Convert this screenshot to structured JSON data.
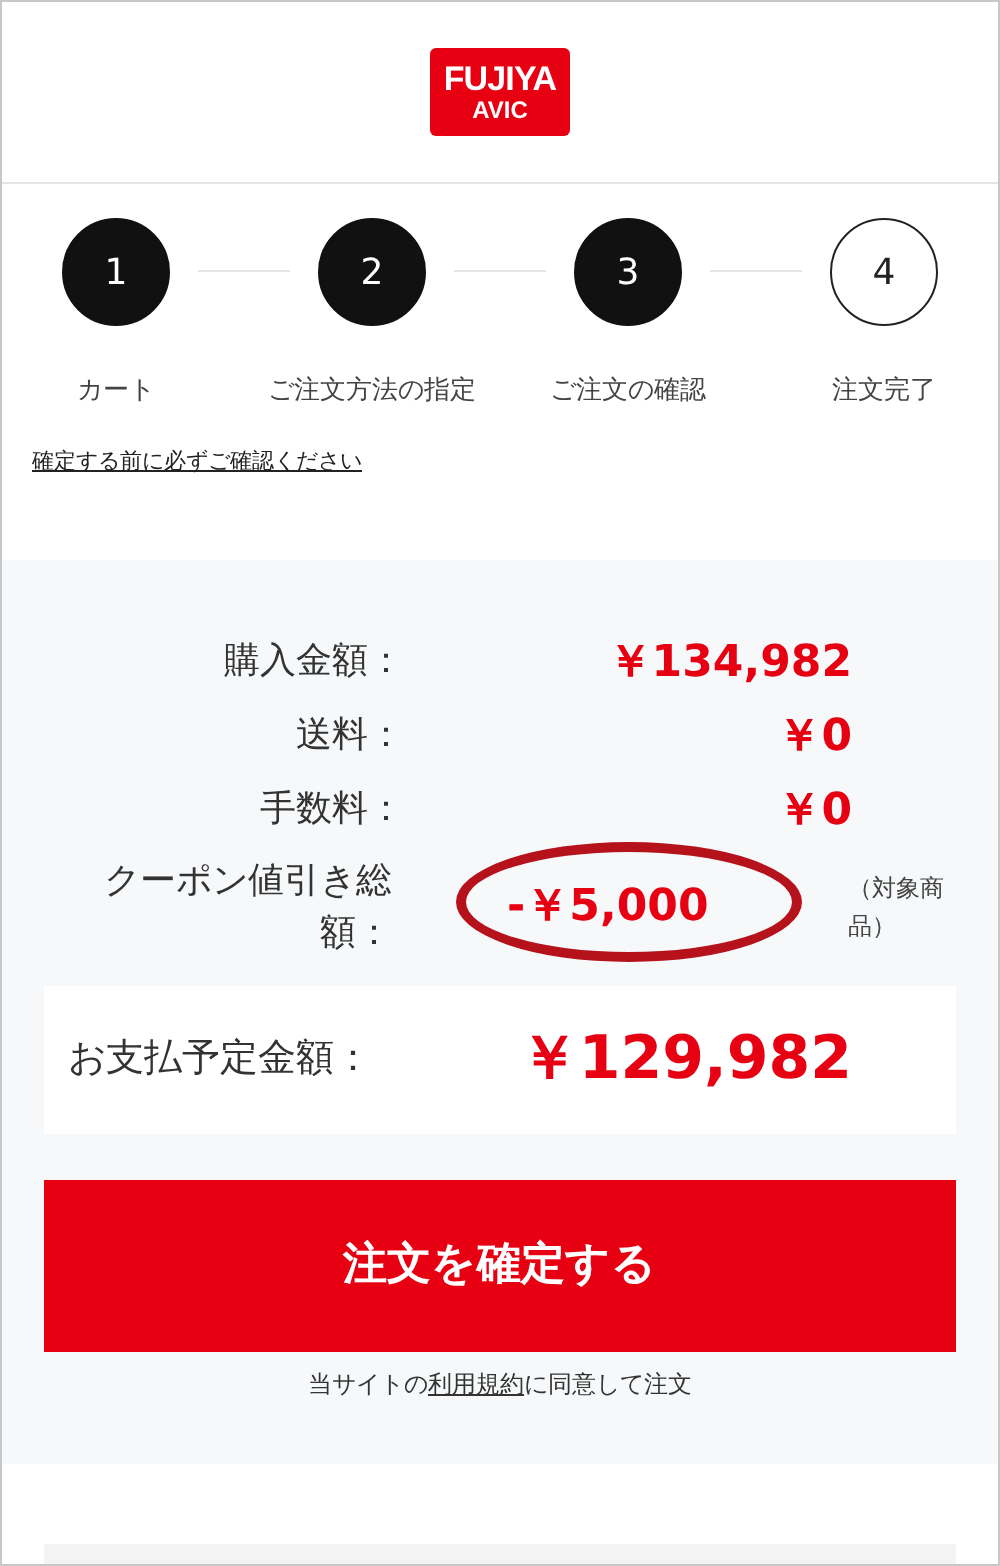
{
  "logo": {
    "line_1": "FUJIYA",
    "line_2": "AVIC"
  },
  "steps": [
    {
      "number": "1",
      "label": "カート",
      "done": true
    },
    {
      "number": "2",
      "label": "ご注文方法の指定",
      "done": true
    },
    {
      "number": "3",
      "label": "ご注文の確認",
      "done": true
    },
    {
      "number": "4",
      "label": "注文完了",
      "done": false
    }
  ],
  "notice_link": "確定する前に必ずご確認ください",
  "summary": [
    {
      "label": "購入金額：",
      "value": "￥134,982",
      "circled": false
    },
    {
      "label": "送料：",
      "value": "￥0",
      "circled": false
    },
    {
      "label": "手数料：",
      "value": "￥0",
      "circled": false
    },
    {
      "label": "クーポン値引き総額：",
      "value": "-￥5,000",
      "note": "（対象商品）",
      "circled": true
    }
  ],
  "total": {
    "label": "お支払予定金額：",
    "value": "￥129,982"
  },
  "confirm_button": "注文を確定する",
  "terms": {
    "before": "当サイトの",
    "link": "利用規約",
    "after": "に同意して注文"
  }
}
